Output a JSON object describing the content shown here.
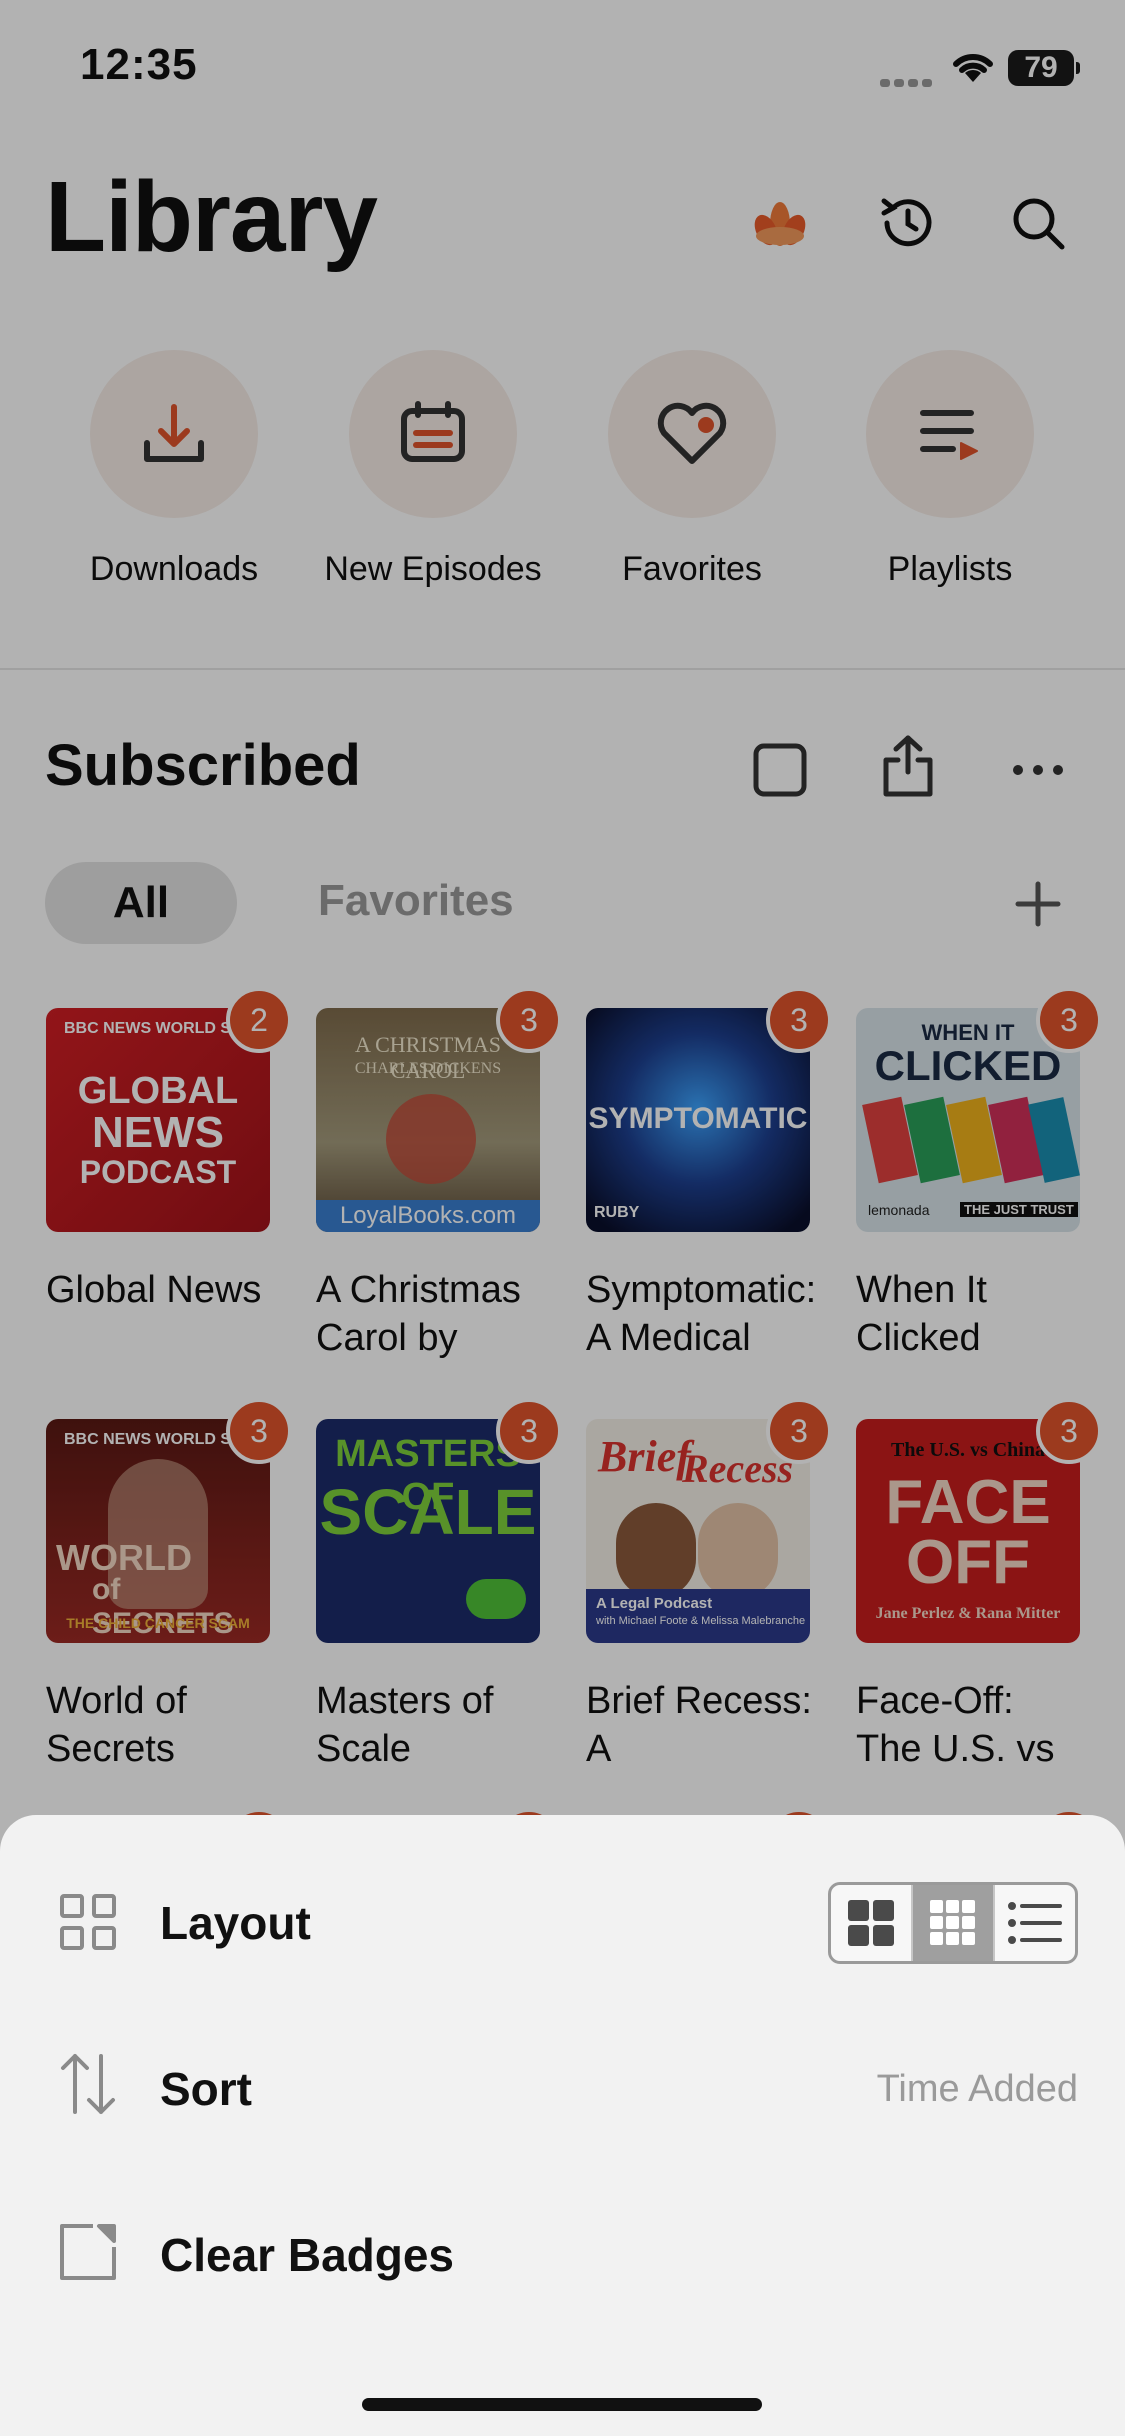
{
  "status_bar": {
    "time": "12:35",
    "battery": "79"
  },
  "header": {
    "title": "Library"
  },
  "quick_actions": [
    {
      "label": "Downloads",
      "icon": "download-icon"
    },
    {
      "label": "New Episodes",
      "icon": "calendar-icon"
    },
    {
      "label": "Favorites",
      "icon": "heart-icon"
    },
    {
      "label": "Playlists",
      "icon": "playlist-icon"
    }
  ],
  "subscribed": {
    "title": "Subscribed",
    "filters": {
      "all": "All",
      "favorites": "Favorites"
    }
  },
  "podcasts": [
    {
      "title": "Global News",
      "badge": "2",
      "art_text": [
        "BBC NEWS WORLD SER",
        "GLOBAL",
        "NEWS",
        "PODCAST"
      ]
    },
    {
      "title": "A Christmas Carol by",
      "badge": "3",
      "art_text": [
        "A CHRISTMAS CAROL",
        "CHARLES DICKENS",
        "LoyalBooks.com"
      ]
    },
    {
      "title": "Symptomatic: A Medical",
      "badge": "3",
      "art_text": [
        "SYMPTOMATIC",
        "RUBY"
      ]
    },
    {
      "title": "When It Clicked",
      "badge": "3",
      "art_text": [
        "WHEN IT",
        "CLICKED",
        "lemonada",
        "THE JUST TRUST"
      ]
    },
    {
      "title": "World of Secrets",
      "badge": "3",
      "art_text": [
        "BBC NEWS WORLD SER",
        "WORLD",
        "of SECRETS",
        "THE CHILD CANCER SCAM"
      ]
    },
    {
      "title": "Masters of Scale",
      "badge": "3",
      "art_text": [
        "MASTERS OF",
        "SCALE"
      ]
    },
    {
      "title": "Brief Recess: A",
      "badge": "3",
      "art_text": [
        "Brief",
        "Recess",
        "A Legal Podcast",
        "with Michael Foote & Melissa Malebranche"
      ]
    },
    {
      "title": "Face-Off: The U.S. vs",
      "badge": "3",
      "art_text": [
        "The U.S. vs China",
        "FACE OFF",
        "Jane Perlez & Rana Mitter"
      ]
    }
  ],
  "sheet": {
    "layout_label": "Layout",
    "sort_label": "Sort",
    "sort_value": "Time Added",
    "clear_badges_label": "Clear Badges",
    "layout_options": [
      "large-grid",
      "small-grid",
      "list"
    ],
    "layout_selected": "small-grid"
  },
  "colors": {
    "accent": "#e0532b",
    "sheet_bg": "#f2f2f2"
  }
}
